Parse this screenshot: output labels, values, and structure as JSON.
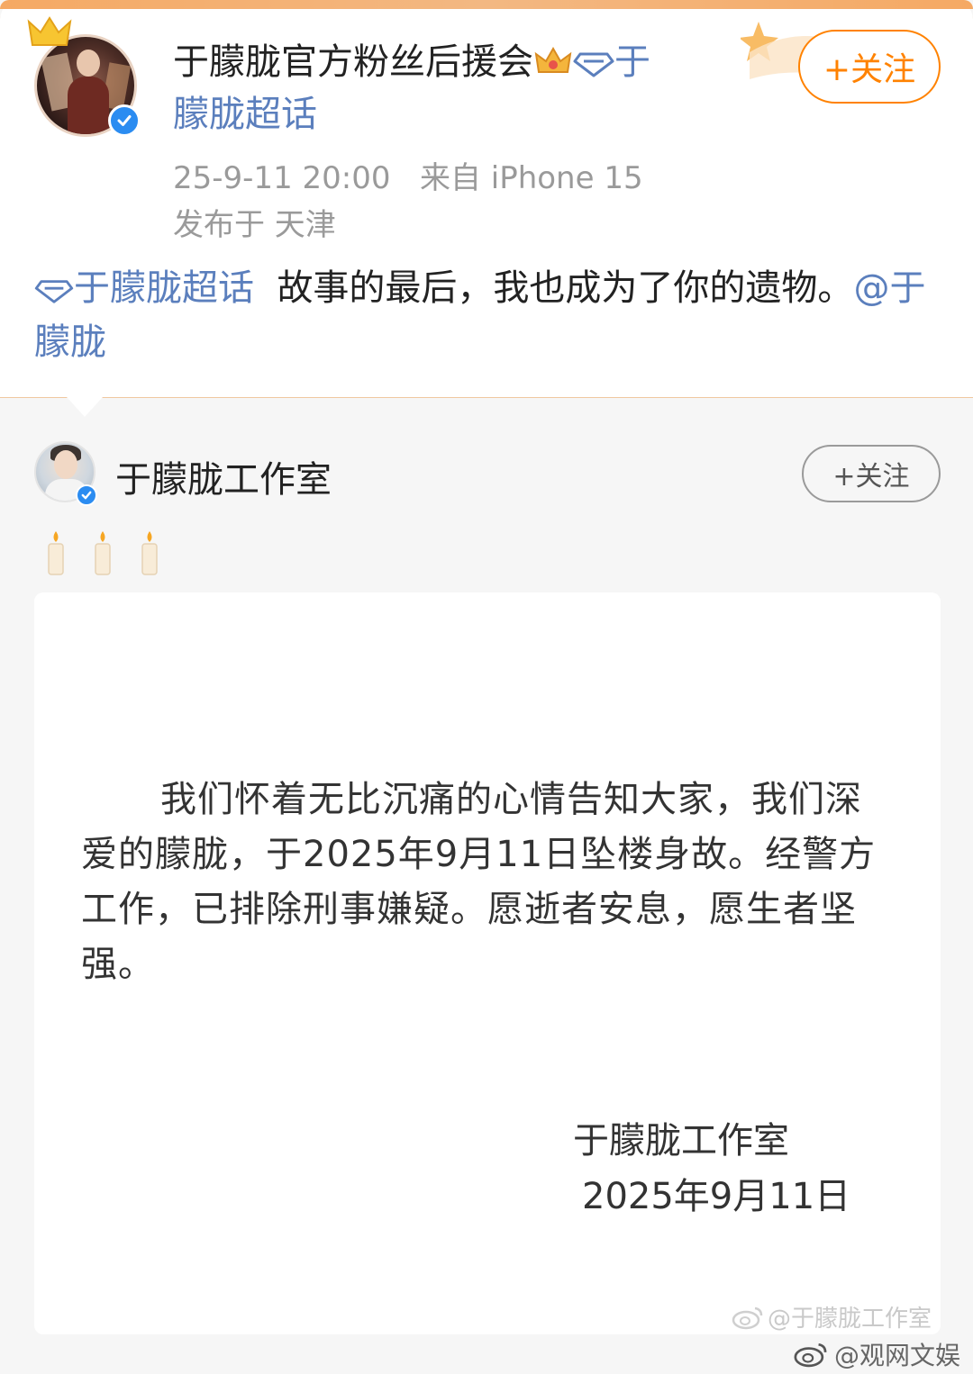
{
  "post": {
    "author_name": "于朦胧官方粉丝后援会",
    "topic_prefix": "于",
    "topic_rest": "朦胧超话",
    "time": "25-9-11 20:00",
    "source": "来自 iPhone 15",
    "location": "发布于 天津",
    "follow_label": "+关注",
    "text_topic": "于朦胧超话",
    "text_main": "故事的最后，我也成为了你的遗物。",
    "text_mention": "@于朦胧"
  },
  "repost": {
    "author_name": "于朦胧工作室",
    "follow_label": "+关注",
    "emoji": "🕯🕯🕯",
    "statement_body": "我们怀着无比沉痛的心情告知大家，我们深爱的朦胧，于2025年9月11日坠楼身故。经警方工作，已排除刑事嫌疑。愿逝者安息，愿生者坚强。",
    "signature": "于朦胧工作室",
    "date": "2025年9月11日"
  },
  "watermarks": {
    "inner": "@于朦胧工作室",
    "outer": "@观网文娱"
  },
  "colors": {
    "accent_orange": "#ff8200",
    "link_blue": "#5b7fbd",
    "verified_blue": "#2b8cf1"
  },
  "icons": [
    "crown-icon",
    "diamond-topic-icon",
    "verified-icon",
    "candle-icon",
    "weibo-logo-icon"
  ]
}
